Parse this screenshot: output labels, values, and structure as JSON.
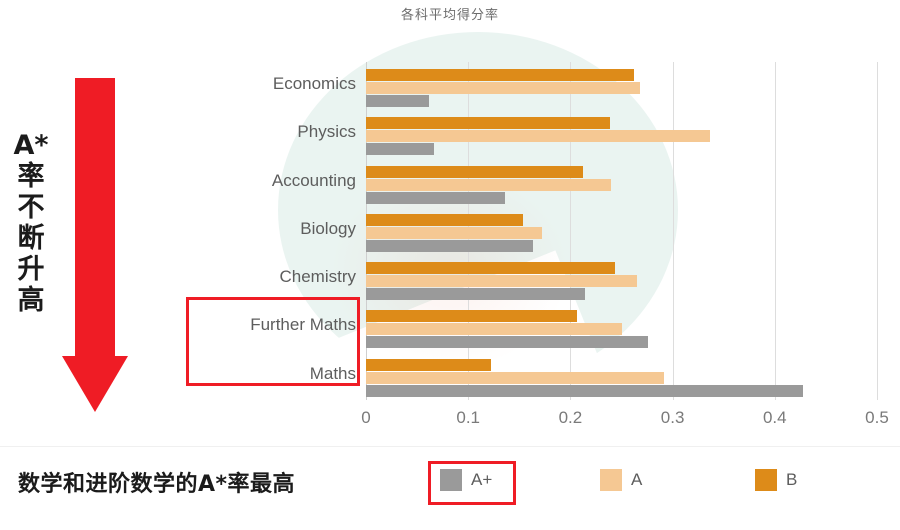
{
  "chart_data": {
    "type": "bar",
    "orientation": "horizontal",
    "title": "各科平均得分率",
    "xlabel": "",
    "ylabel": "",
    "xlim": [
      0,
      0.5
    ],
    "xticks": [
      "0",
      "0.1",
      "0.2",
      "0.3",
      "0.4",
      "0.5"
    ],
    "xtick_values": [
      0,
      0.1,
      0.2,
      0.3,
      0.4,
      0.5
    ],
    "grid": true,
    "legend_position": "bottom",
    "categories": [
      "Economics",
      "Physics",
      "Accounting",
      "Biology",
      "Chemistry",
      "Further Maths",
      "Maths"
    ],
    "series": [
      {
        "name": "A+",
        "color": "#9a9a9a",
        "values": [
          0.062,
          0.067,
          0.136,
          0.163,
          0.214,
          0.276,
          0.428
        ]
      },
      {
        "name": "A",
        "color": "#f5c893",
        "values": [
          0.268,
          0.337,
          0.24,
          0.172,
          0.265,
          0.25,
          0.292
        ]
      },
      {
        "name": "B",
        "color": "#dd8b19",
        "values": [
          0.262,
          0.239,
          0.212,
          0.154,
          0.244,
          0.206,
          0.122
        ]
      }
    ]
  },
  "legend": {
    "items": [
      {
        "label": "A+",
        "color": "#9a9a9a",
        "highlighted": true
      },
      {
        "label": "A",
        "color": "#f5c893",
        "highlighted": false
      },
      {
        "label": "B",
        "color": "#dd8b19",
        "highlighted": false
      }
    ]
  },
  "annotations": {
    "vertical_text_lines": [
      "A*",
      "率",
      "不",
      "断",
      "升",
      "高"
    ],
    "arrow_color": "#ef1c25",
    "highlight_color": "#ef1c25",
    "caption": "数学和进阶数学的A*率最高",
    "highlighted_categories": [
      "Further Maths",
      "Maths"
    ]
  }
}
